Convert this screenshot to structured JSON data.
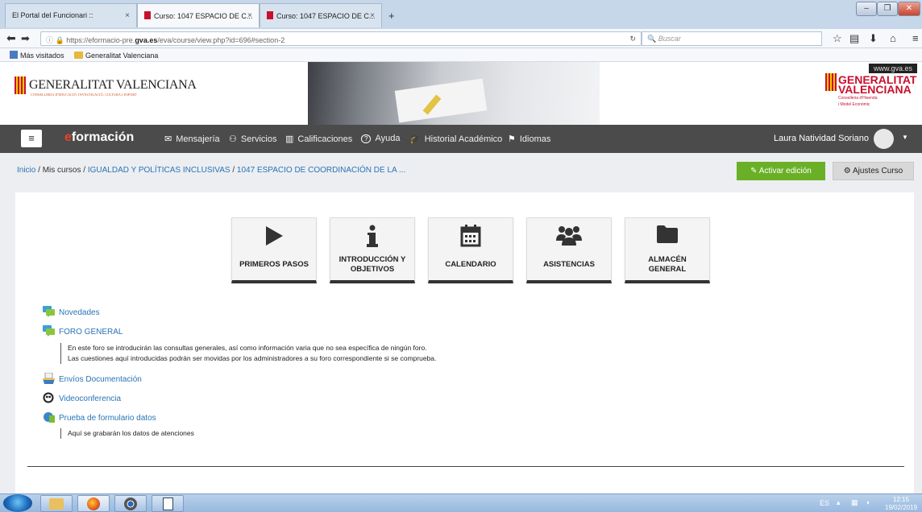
{
  "browser": {
    "tabs": [
      {
        "title": "El Portal del Funcionari ::"
      },
      {
        "title": "Curso: 1047 ESPACIO DE C..."
      },
      {
        "title": "Curso: 1047 ESPACIO DE C..."
      }
    ],
    "new_tab": "+",
    "close_glyph": "×",
    "url_prefix": "https://eformacio-pre.",
    "url_domain": "gva.es",
    "url_suffix": "/eva/course/view.php?id=696#section-2",
    "search_placeholder": "Buscar",
    "bookmarks": [
      {
        "label": "Más visitados"
      },
      {
        "label": "Generalitat Valenciana"
      }
    ]
  },
  "header": {
    "logo_text": "GENERALITAT VALENCIANA",
    "logo_subtext": "CONSELLERIA D'EDUCACIÓ, INVESTIGACIÓ, CULTURA I ESPORT",
    "site_url": "www.gva.es",
    "right_logo_line1": "GENERALITAT",
    "right_logo_line2": "VALENCIANA",
    "right_logo_sub1": "Conselleria d'Hisenda",
    "right_logo_sub2": "i Model Econòmic"
  },
  "nav": {
    "menu_glyph": "≡",
    "brand_e": "e",
    "brand_rest": "formación",
    "items": [
      {
        "icon": "envelope-icon",
        "glyph": "✉",
        "label": "Mensajería"
      },
      {
        "icon": "sitemap-icon",
        "glyph": "⚇",
        "label": "Servicios"
      },
      {
        "icon": "chart-icon",
        "glyph": "▥",
        "label": "Calificaciones"
      },
      {
        "icon": "help-icon",
        "glyph": "?",
        "label": "Ayuda"
      },
      {
        "icon": "graduation-cap-icon",
        "glyph": "🎓",
        "label": "Historial Académico"
      },
      {
        "icon": "flag-icon",
        "glyph": "⚑",
        "label": "Idiomas"
      }
    ],
    "user_name": "Laura Natividad Soriano"
  },
  "breadcrumb": {
    "home": "Inicio",
    "sep": "/",
    "my_courses": "Mis cursos",
    "category": "IGUALDAD Y POLÍTICAS INCLUSIVAS",
    "course": "1047 ESPACIO DE COORDINACIÓN DE LA ..."
  },
  "buttons": {
    "edit": "Activar edición",
    "settings": "Ajustes Curso"
  },
  "tiles": [
    {
      "icon": "play-icon",
      "label": "PRIMEROS PASOS"
    },
    {
      "icon": "info-icon",
      "label": "INTRODUCCIÓN Y OBJETIVOS"
    },
    {
      "icon": "calendar-icon",
      "label": "CALENDARIO"
    },
    {
      "icon": "users-icon",
      "label": "ASISTENCIAS"
    },
    {
      "icon": "folder-icon",
      "label": "ALMACÉN GENERAL"
    }
  ],
  "activities": [
    {
      "icon": "forum-icon",
      "label": "Novedades"
    },
    {
      "icon": "forum-icon",
      "label": "FORO GENERAL",
      "description_1": "En este foro se introducirán las consultas generales, así como información varia que no sea específica de ningún foro.",
      "description_2": "Las cuestiones aquí introducidas podrán ser movidas por los administradores a su foro correspondiente si se comprueba."
    },
    {
      "icon": "assignment-icon",
      "label": "Envíos Documentación"
    },
    {
      "icon": "videoconference-icon",
      "label": "Videoconferencia"
    },
    {
      "icon": "database-icon",
      "label": "Prueba de formulario datos",
      "description_1": "Aquí se grabarán los datos de atenciones"
    }
  ],
  "taskbar": {
    "language": "ES",
    "time": "12:15",
    "date": "19/02/2019"
  },
  "colors": {
    "accent_green": "#6ab026",
    "link_blue": "#2a73b7",
    "nav_dark": "#4b4b4b",
    "brand_red": "#e8432b"
  }
}
